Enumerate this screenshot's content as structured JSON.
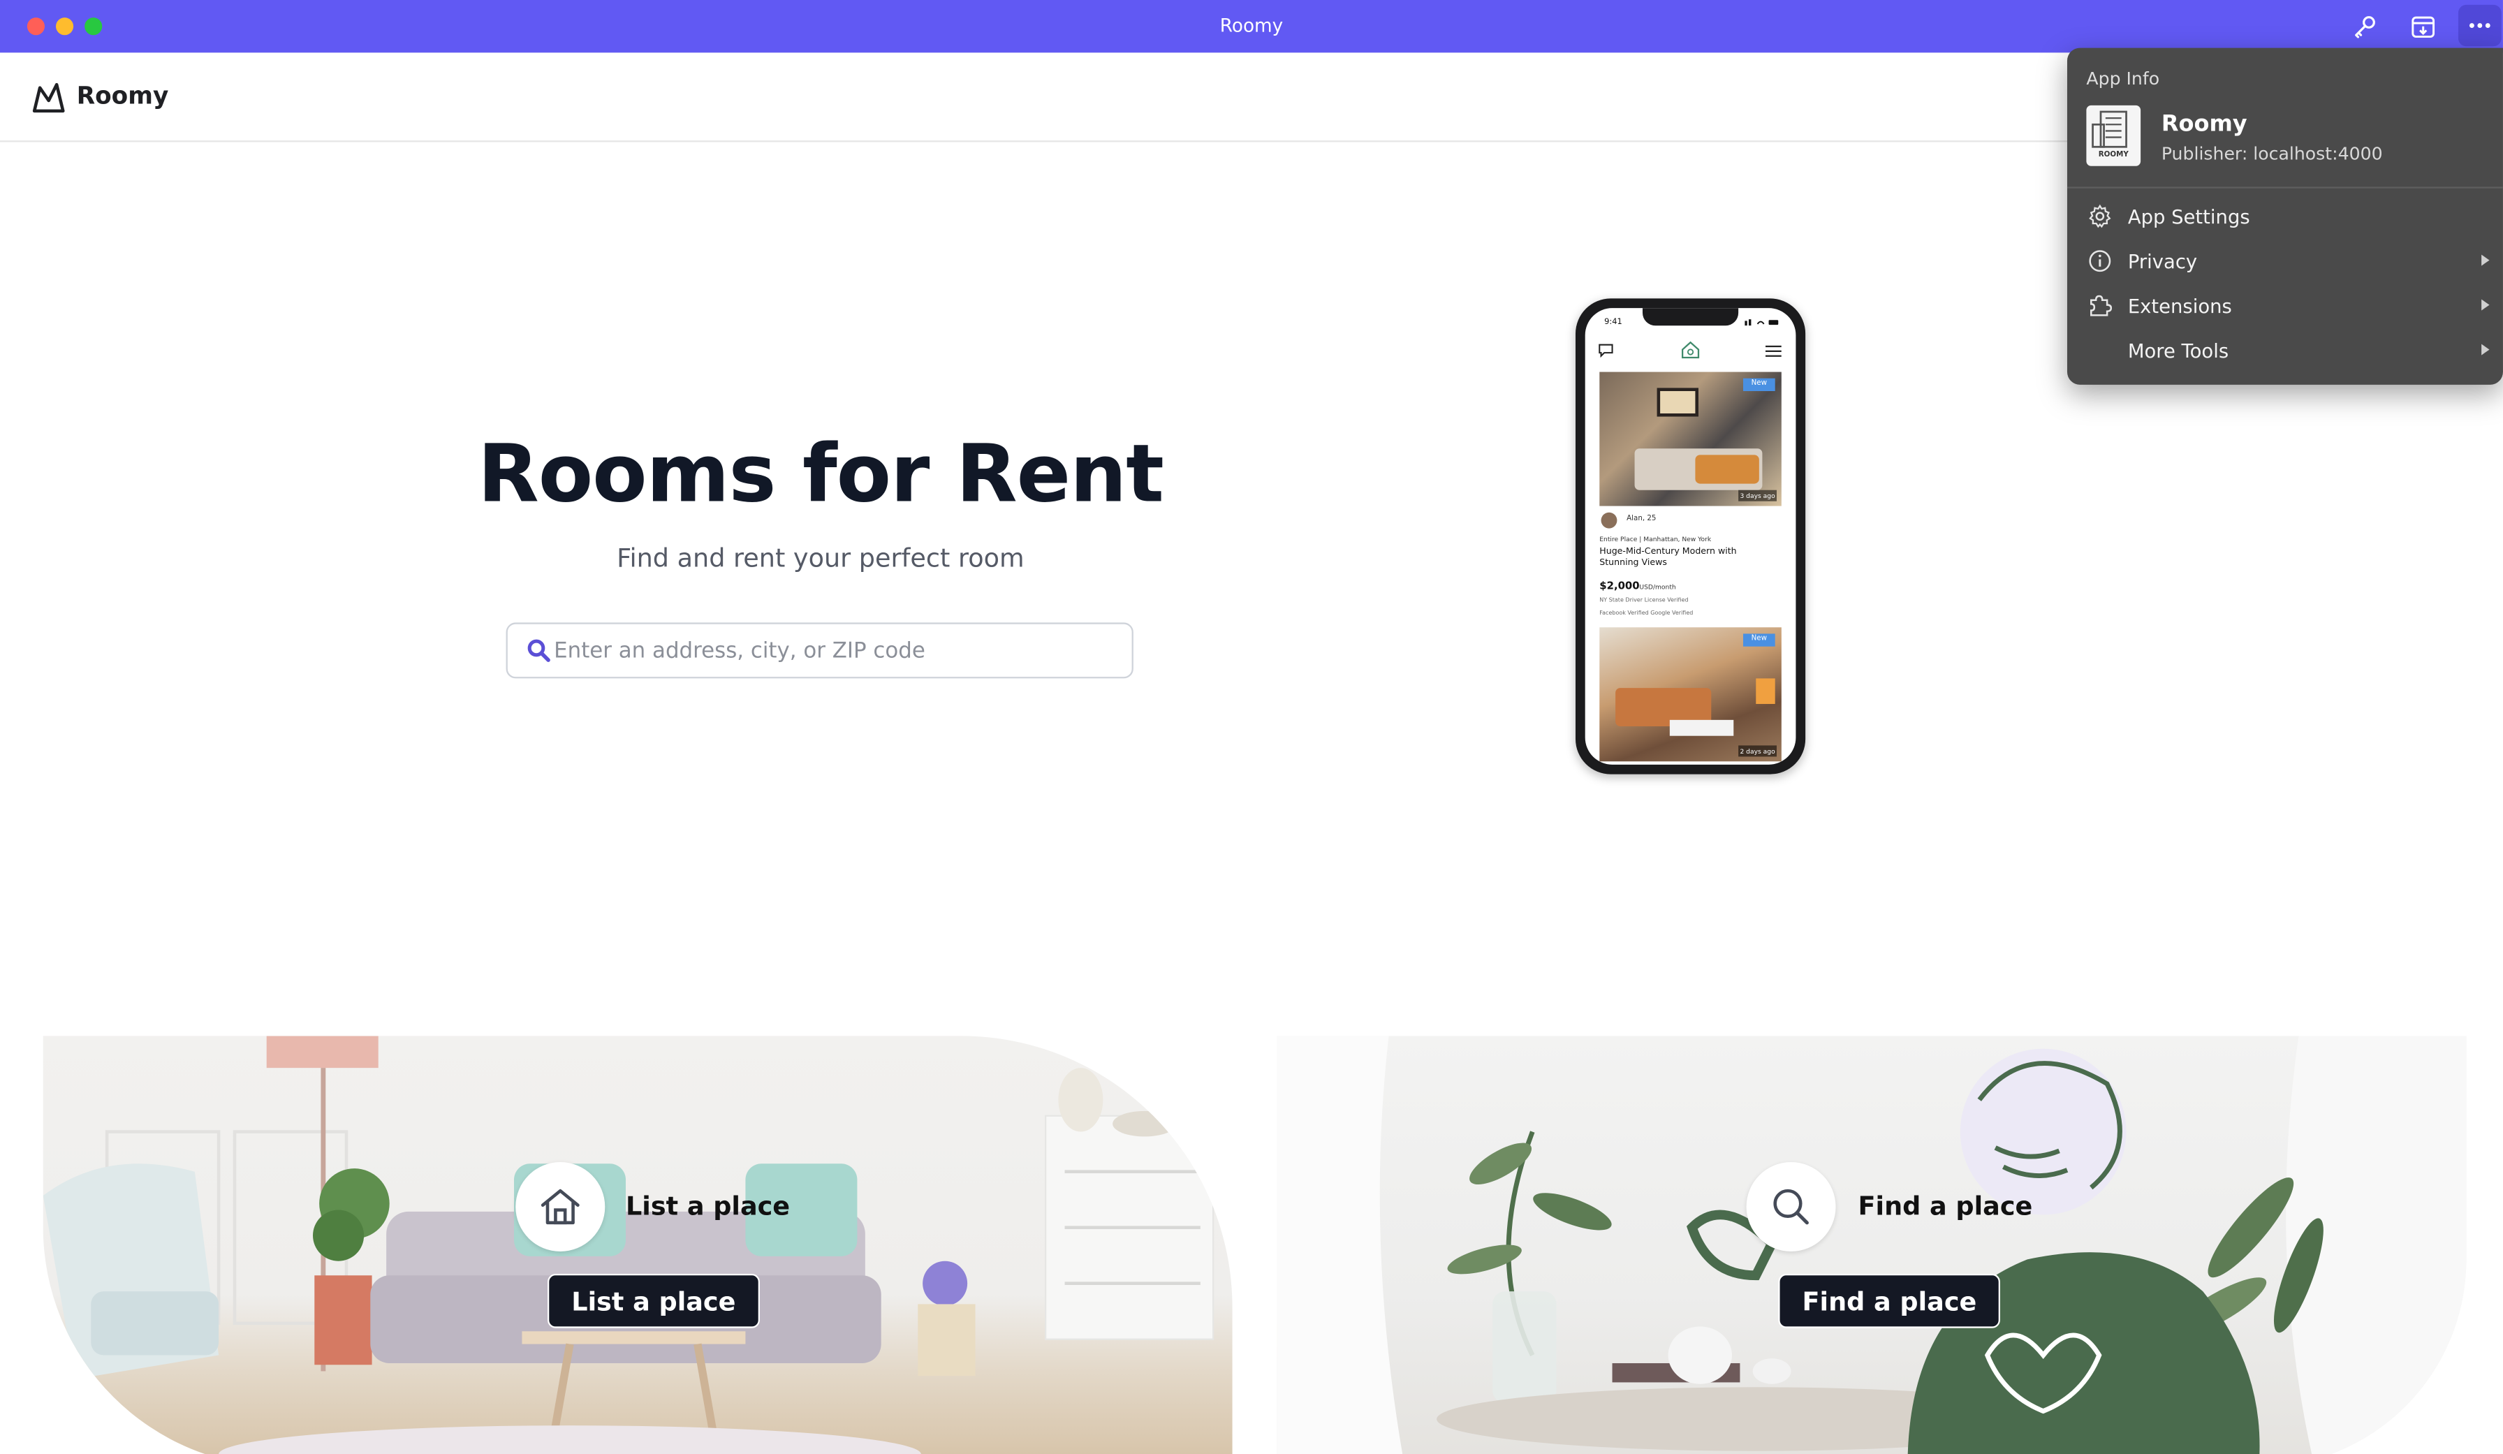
{
  "window": {
    "title": "Roomy"
  },
  "header": {
    "brand": "Roomy"
  },
  "hero": {
    "title": "Rooms for Rent",
    "subtitle": "Find and rent your perfect room",
    "search_placeholder": "Enter an address, city, or ZIP code"
  },
  "phone": {
    "time": "9:41",
    "badge_new": "New",
    "days_ago_1": "3 days ago",
    "days_ago_2": "2 days ago",
    "user": "Alan, 25",
    "listing_type": "Entire Place  |  Manhattan, New York",
    "listing_title": "Huge-Mid-Century Modern  with Stunning Views",
    "price": "$2,000",
    "price_unit": "USD/month",
    "verify_1": "NY State Driver License Verified",
    "verify_2": "Facebook Verified    Google Verified"
  },
  "cards": {
    "list": {
      "heading": "List a place",
      "button": "List a place",
      "icon": "house-icon"
    },
    "find": {
      "heading": "Find a place",
      "button": "Find a place",
      "icon": "search-icon"
    }
  },
  "app_menu": {
    "heading": "App Info",
    "app_name": "Roomy",
    "publisher": "Publisher: localhost:4000",
    "icon_text": "ROOMY",
    "items": [
      {
        "label": "App Settings",
        "icon": "gear-icon",
        "submenu": false
      },
      {
        "label": "Privacy",
        "icon": "info-icon",
        "submenu": true
      },
      {
        "label": "Extensions",
        "icon": "puzzle-icon",
        "submenu": true
      },
      {
        "label": "More Tools",
        "icon": "",
        "submenu": true
      }
    ]
  },
  "colors": {
    "titlebar": "#6159f3",
    "accent": "#5b4fd6",
    "button_dark": "#141824",
    "menu_bg": "#4a4a4a"
  }
}
